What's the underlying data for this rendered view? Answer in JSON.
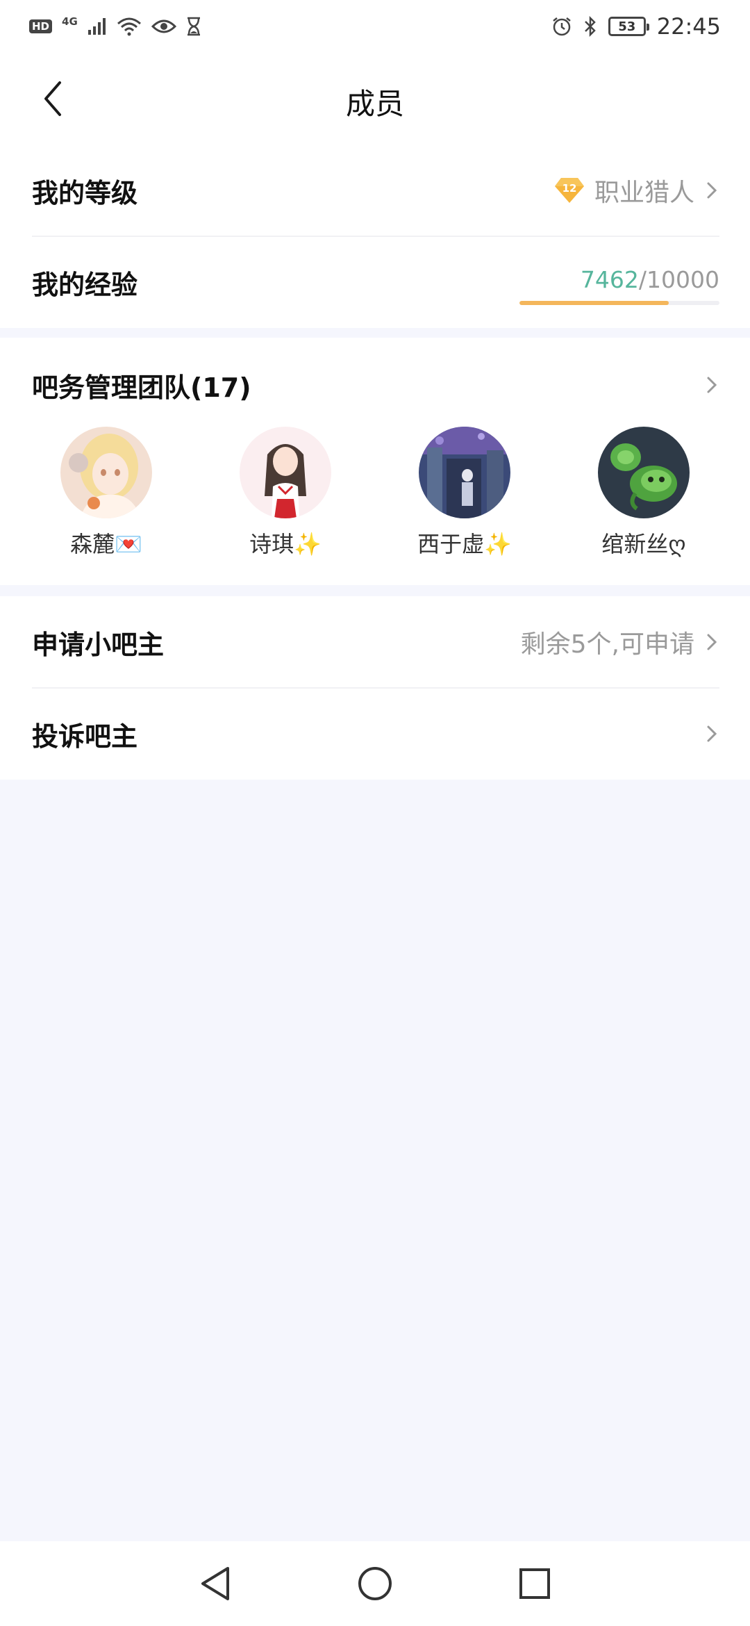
{
  "status_bar": {
    "hd": "HD",
    "network": "4G",
    "battery": "53",
    "time": "22:45",
    "icons": [
      "hd-icon",
      "signal-icon",
      "wifi-icon",
      "eye-icon",
      "hourglass-icon",
      "alarm-icon",
      "bluetooth-icon",
      "battery-icon"
    ]
  },
  "header": {
    "title": "成员",
    "back_icon": "chevron-left-icon"
  },
  "level": {
    "label": "我的等级",
    "badge_number": "12",
    "badge_color": "#f6b53d",
    "rank": "职业猎人"
  },
  "experience": {
    "label": "我的经验",
    "current": "7462",
    "separator": "/",
    "max": "10000",
    "progress": 0.7462,
    "current_color": "#56b59c",
    "bar_color": "#f4b65b"
  },
  "team": {
    "title": "吧务管理团队(17)",
    "members": [
      {
        "name": "森麓💌"
      },
      {
        "name": "诗琪✨"
      },
      {
        "name": "西于虚✨"
      },
      {
        "name": "绾新丝ღ"
      }
    ]
  },
  "apply": {
    "label": "申请小吧主",
    "status": "剩余5个,可申请"
  },
  "complain": {
    "label": "投诉吧主"
  },
  "nav": {
    "icons": [
      "back-triangle-icon",
      "home-circle-icon",
      "recents-square-icon"
    ]
  }
}
